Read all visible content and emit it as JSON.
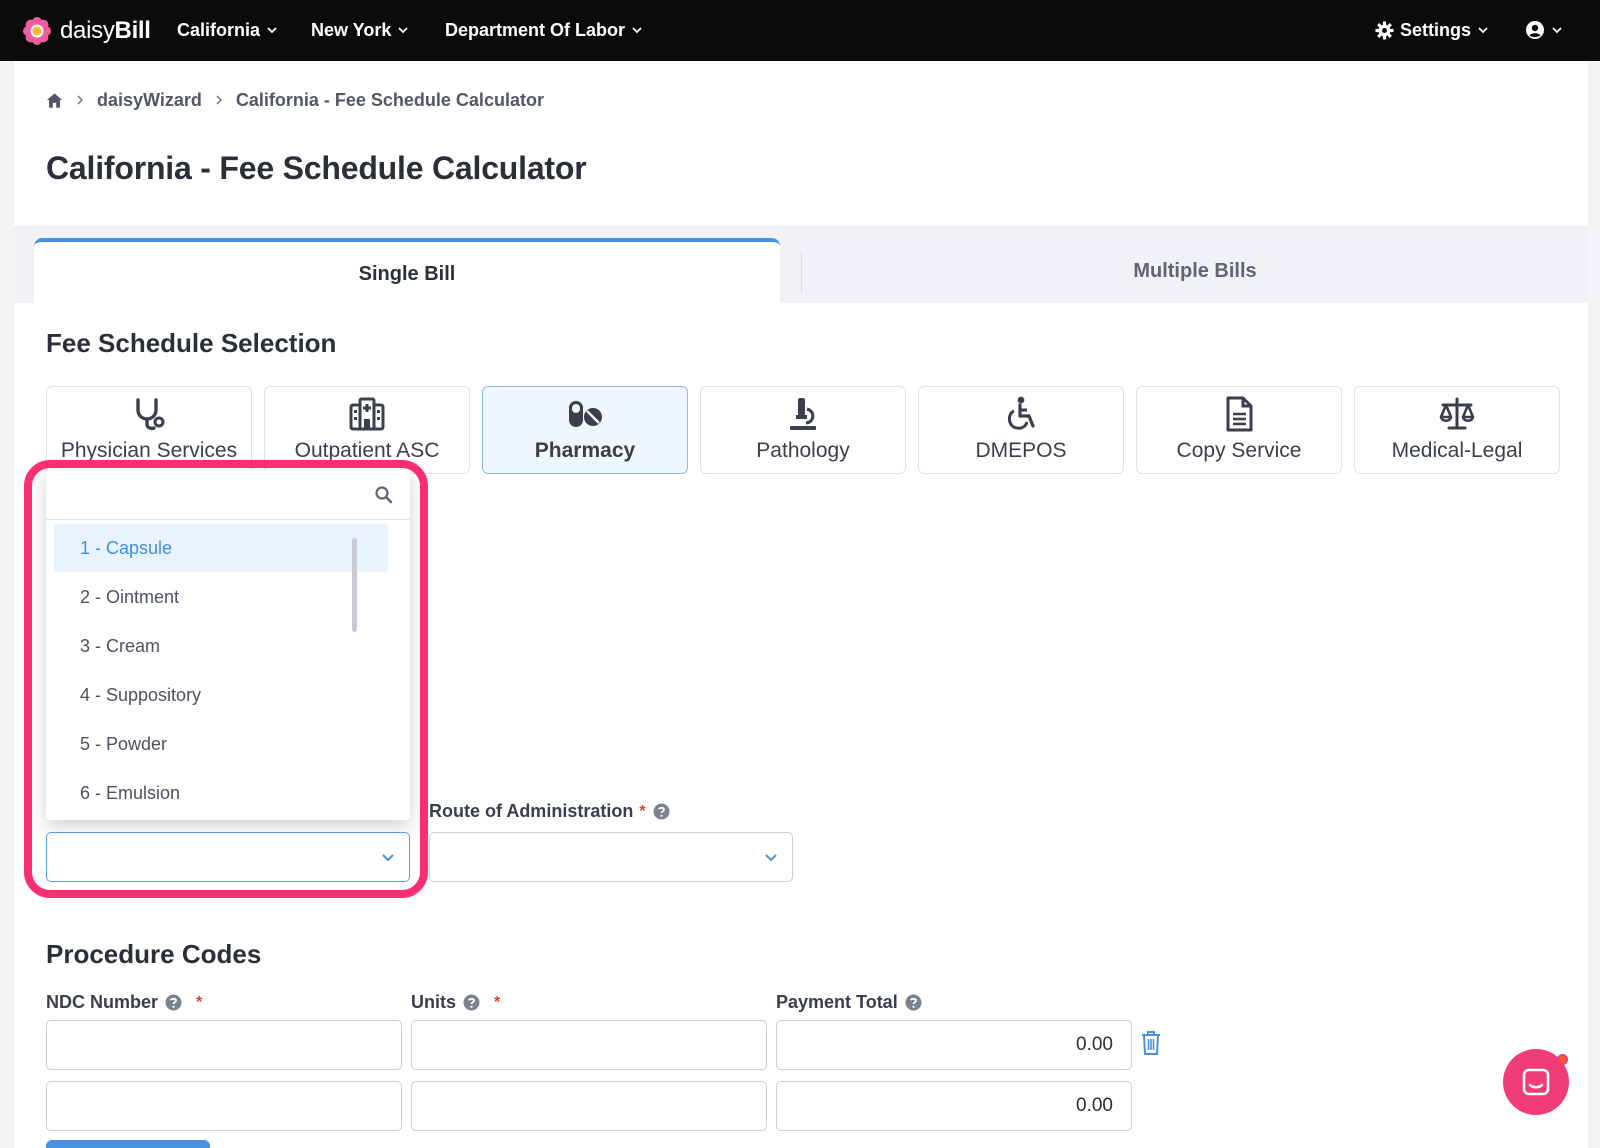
{
  "nav": {
    "brand_prefix": "daisy",
    "brand_bold": "Bill",
    "items": [
      {
        "label": "California"
      },
      {
        "label": "New York"
      },
      {
        "label": "Department Of Labor"
      }
    ],
    "settings_label": "Settings"
  },
  "breadcrumb": {
    "items": [
      "daisyWizard",
      "California - Fee Schedule Calculator"
    ]
  },
  "page": {
    "title": "California - Fee Schedule Calculator"
  },
  "tabs": [
    {
      "label": "Single Bill",
      "active": true
    },
    {
      "label": "Multiple Bills",
      "active": false
    }
  ],
  "fee_schedule": {
    "title": "Fee Schedule Selection",
    "cards": [
      {
        "label": "Physician Services",
        "icon": "stethoscope-icon"
      },
      {
        "label": "Outpatient ASC",
        "icon": "hospital-icon"
      },
      {
        "label": "Pharmacy",
        "icon": "pills-icon",
        "selected": true
      },
      {
        "label": "Pathology",
        "icon": "microscope-icon"
      },
      {
        "label": "DMEPOS",
        "icon": "wheelchair-icon"
      },
      {
        "label": "Copy Service",
        "icon": "document-icon"
      },
      {
        "label": "Medical-Legal",
        "icon": "scales-icon"
      }
    ]
  },
  "dropdown": {
    "search_value": "",
    "options": [
      {
        "label": "1 - Capsule",
        "highlighted": true
      },
      {
        "label": "2 - Ointment"
      },
      {
        "label": "3 - Cream"
      },
      {
        "label": "4 - Suppository"
      },
      {
        "label": "5 - Powder"
      },
      {
        "label": "6 - Emulsion"
      }
    ]
  },
  "route_of_administration": {
    "label": "Route of Administration",
    "required_mark": "*",
    "value": ""
  },
  "procedure_codes": {
    "title": "Procedure Codes",
    "columns": {
      "ndc": "NDC Number",
      "units": "Units",
      "payment": "Payment Total"
    },
    "required_mark": "*",
    "rows": [
      {
        "ndc": "",
        "units": "",
        "payment": "0.00"
      },
      {
        "ndc": "",
        "units": "",
        "payment": "0.00"
      }
    ]
  },
  "colors": {
    "accent": "#4a90e2",
    "highlight": "#fb2e74",
    "nav_bg": "#0b0b0c"
  }
}
